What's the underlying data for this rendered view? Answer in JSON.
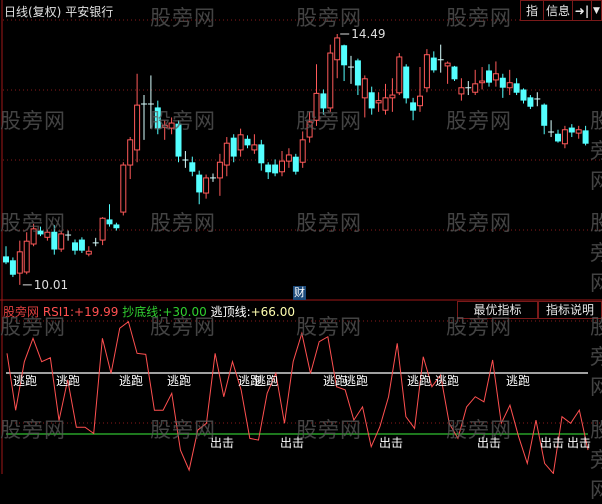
{
  "header": {
    "period": "日线(复权)",
    "stock_name": "平安银行"
  },
  "toolbar": {
    "zhi_label": "指",
    "info_label": "信息",
    "arrow_icon": "arrow-right-bar-icon",
    "dropdown_icon": "chevron-down-icon"
  },
  "watermark": "股旁网",
  "finance_badge": "财",
  "colors": {
    "up": "#ff5a5a",
    "down": "#54ffff",
    "rsi": "#ff5050",
    "top_line": "#ffffff",
    "bottom_line": "#30c030",
    "grid": "#8a1a1a"
  },
  "indicator": {
    "name": "股旁网",
    "rsi_label": "RSI1:",
    "rsi_value": "+19.99",
    "bottom_label": "抄底线:",
    "bottom_value": "+30.00",
    "top_label": "逃顶线:",
    "top_value": "+66.00",
    "btn_best": "最优指标",
    "btn_help": "指标说明"
  },
  "chart_data": [
    {
      "type": "candlestick",
      "max_label": "14.49",
      "min_label": "10.01",
      "ohlc_fields": [
        "open",
        "high",
        "low",
        "close"
      ],
      "candles": [
        [
          10.51,
          10.7,
          10.38,
          10.42
        ],
        [
          10.44,
          10.5,
          10.15,
          10.2
        ],
        [
          10.22,
          10.8,
          10.01,
          10.6
        ],
        [
          10.24,
          10.95,
          10.2,
          10.79
        ],
        [
          10.74,
          11.1,
          10.7,
          11.01
        ],
        [
          10.97,
          11.05,
          10.88,
          10.92
        ],
        [
          10.86,
          11.0,
          10.8,
          10.95
        ],
        [
          10.95,
          11.08,
          10.55,
          10.65
        ],
        [
          10.65,
          10.98,
          10.6,
          10.92
        ],
        [
          10.9,
          10.98,
          10.8,
          10.9
        ],
        [
          10.76,
          10.82,
          10.55,
          10.63
        ],
        [
          10.81,
          10.86,
          10.58,
          10.63
        ],
        [
          10.56,
          10.7,
          10.52,
          10.61
        ],
        [
          10.76,
          10.85,
          10.7,
          10.76
        ],
        [
          10.81,
          11.22,
          10.72,
          11.2
        ],
        [
          11.17,
          11.45,
          11.05,
          11.1
        ],
        [
          11.08,
          11.12,
          10.98,
          11.03
        ],
        [
          11.31,
          12.2,
          11.25,
          12.15
        ],
        [
          12.15,
          12.65,
          11.9,
          12.6
        ],
        [
          12.42,
          13.78,
          12.2,
          13.22
        ],
        [
          13.24,
          13.4,
          12.6,
          13.24
        ],
        [
          13.24,
          13.75,
          12.8,
          13.24
        ],
        [
          13.17,
          13.3,
          12.7,
          12.81
        ],
        [
          12.82,
          12.95,
          12.6,
          12.86
        ],
        [
          12.81,
          13.0,
          12.7,
          12.9
        ],
        [
          12.88,
          12.95,
          12.2,
          12.31
        ],
        [
          12.24,
          12.4,
          12.1,
          12.24
        ],
        [
          12.19,
          12.3,
          11.95,
          12.04
        ],
        [
          11.97,
          12.05,
          11.45,
          11.67
        ],
        [
          11.65,
          11.98,
          11.55,
          11.92
        ],
        [
          11.92,
          12.0,
          11.85,
          11.92
        ],
        [
          11.92,
          12.35,
          11.6,
          12.2
        ],
        [
          12.15,
          12.65,
          11.95,
          12.54
        ],
        [
          12.63,
          12.7,
          12.2,
          12.31
        ],
        [
          12.42,
          12.8,
          12.3,
          12.69
        ],
        [
          12.61,
          12.68,
          12.45,
          12.51
        ],
        [
          12.42,
          12.7,
          12.35,
          12.51
        ],
        [
          12.51,
          12.6,
          12.05,
          12.19
        ],
        [
          12.15,
          12.2,
          11.9,
          12.03
        ],
        [
          12.15,
          12.25,
          11.95,
          12.01
        ],
        [
          12.03,
          12.4,
          11.95,
          12.22
        ],
        [
          12.22,
          12.45,
          12.1,
          12.33
        ],
        [
          12.29,
          12.35,
          11.98,
          12.04
        ],
        [
          12.2,
          12.75,
          12.1,
          12.6
        ],
        [
          12.65,
          13.1,
          12.55,
          12.92
        ],
        [
          12.95,
          13.95,
          12.85,
          13.43
        ],
        [
          13.42,
          13.5,
          13.05,
          13.17
        ],
        [
          13.17,
          14.3,
          13.1,
          14.15
        ],
        [
          14.03,
          14.49,
          13.7,
          14.42
        ],
        [
          14.28,
          14.3,
          13.65,
          13.94
        ],
        [
          13.9,
          14.1,
          13.6,
          13.9
        ],
        [
          14.01,
          14.05,
          13.4,
          13.58
        ],
        [
          13.35,
          13.75,
          13.0,
          13.69
        ],
        [
          13.44,
          13.55,
          13.05,
          13.17
        ],
        [
          13.26,
          13.45,
          13.1,
          13.3
        ],
        [
          13.13,
          13.6,
          13.05,
          13.35
        ],
        [
          13.35,
          13.7,
          13.1,
          13.4
        ],
        [
          13.44,
          14.15,
          13.4,
          14.08
        ],
        [
          13.9,
          13.95,
          13.25,
          13.35
        ],
        [
          13.26,
          13.35,
          12.95,
          13.13
        ],
        [
          13.21,
          13.9,
          13.1,
          13.38
        ],
        [
          13.53,
          14.22,
          13.45,
          14.12
        ],
        [
          14.06,
          14.18,
          13.8,
          13.85
        ],
        [
          14.03,
          14.3,
          13.8,
          14.03
        ],
        [
          13.92,
          14.0,
          13.6,
          13.97
        ],
        [
          13.9,
          13.92,
          13.65,
          13.69
        ],
        [
          13.42,
          13.7,
          13.3,
          13.53
        ],
        [
          13.53,
          13.65,
          13.4,
          13.53
        ],
        [
          13.45,
          13.85,
          13.4,
          13.6
        ],
        [
          13.62,
          13.9,
          13.5,
          13.65
        ],
        [
          13.83,
          13.95,
          13.55,
          13.63
        ],
        [
          13.67,
          14.0,
          13.55,
          13.78
        ],
        [
          13.7,
          13.78,
          13.35,
          13.54
        ],
        [
          13.53,
          13.85,
          13.4,
          13.62
        ],
        [
          13.6,
          13.7,
          13.4,
          13.45
        ],
        [
          13.49,
          13.52,
          13.25,
          13.31
        ],
        [
          13.35,
          13.4,
          13.15,
          13.2
        ],
        [
          13.33,
          13.45,
          13.2,
          13.33
        ],
        [
          13.22,
          13.25,
          12.7,
          12.86
        ],
        [
          12.72,
          12.95,
          12.65,
          12.74
        ],
        [
          12.7,
          12.78,
          12.55,
          12.58
        ],
        [
          12.53,
          12.85,
          12.45,
          12.78
        ],
        [
          12.81,
          12.88,
          12.65,
          12.74
        ],
        [
          12.72,
          12.85,
          12.62,
          12.78
        ],
        [
          12.76,
          12.85,
          12.5,
          12.54
        ]
      ]
    },
    {
      "type": "line",
      "series": [
        {
          "name": "RSI1",
          "values": [
            77.6,
            44,
            72.7,
            86.5,
            72.7,
            75,
            38,
            62,
            34,
            34,
            30.3,
            86.5,
            65.8,
            92.4,
            96.3,
            77.6,
            77,
            44,
            44,
            54,
            20.5,
            8.7,
            32.3,
            36.3,
            77.6,
            52,
            72.7,
            56,
            27.4,
            26.4,
            54,
            65.8,
            36.3,
            72.7,
            89.4,
            65.8,
            84.5,
            87.4,
            57.9,
            56,
            38.2,
            46,
            22.5,
            34.3,
            52,
            83.5,
            40.2,
            33.3,
            75.6,
            57.9,
            64.8,
            36.3,
            27.4,
            46,
            52,
            49,
            73.7,
            36.3,
            47,
            28.4,
            12.6,
            38.2,
            12.6,
            6.7,
            40.2,
            36.3,
            44.1,
            20.5
          ]
        }
      ],
      "reference_lines": [
        {
          "label": "逃顶线",
          "value": 66
        },
        {
          "label": "抄底线",
          "value": 30
        }
      ],
      "sell_signal_text": "逃跑",
      "buy_signal_text": "出击",
      "sell_signal_count": 11,
      "buy_signal_count": 6
    }
  ]
}
